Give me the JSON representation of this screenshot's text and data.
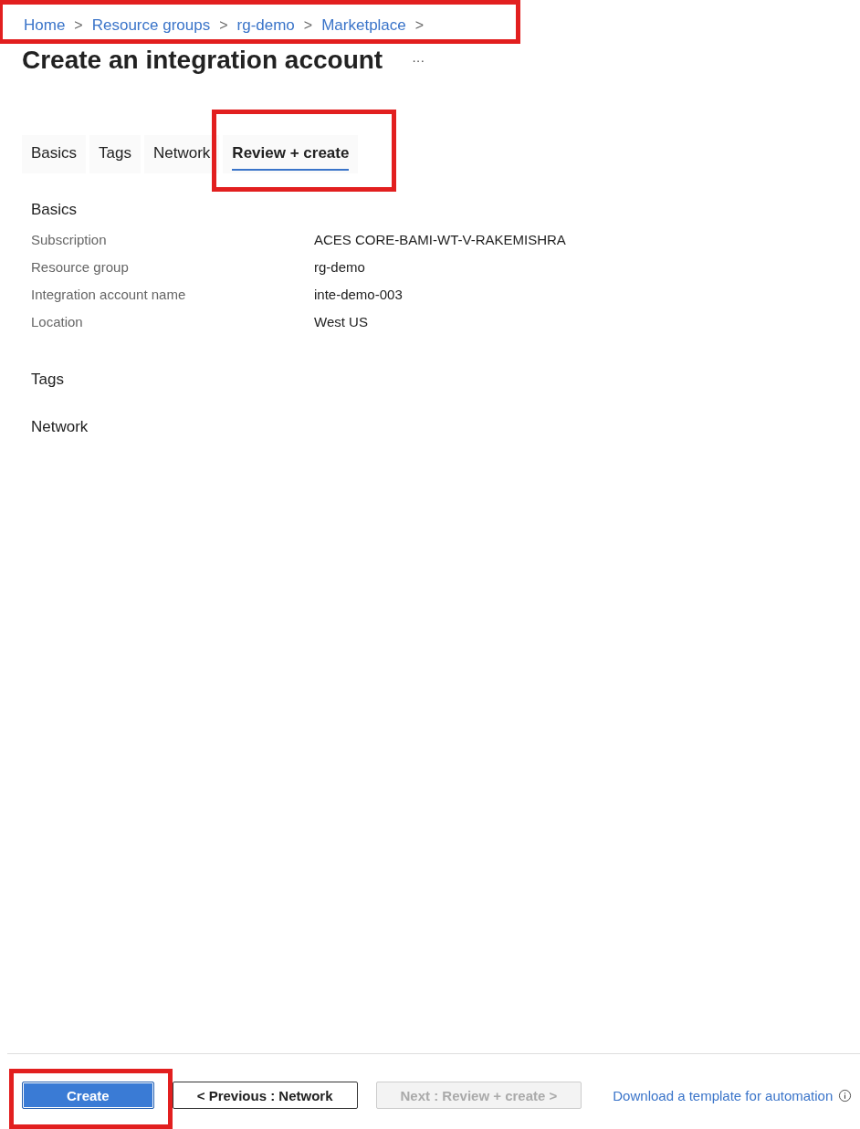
{
  "breadcrumb": {
    "highlighted": true,
    "items": [
      "Home",
      "Resource groups",
      "rg-demo",
      "Marketplace"
    ],
    "separator": ">"
  },
  "title": "Create an integration account",
  "more": "···",
  "tabs": [
    {
      "label": "Basics",
      "selected": false,
      "highlighted": false
    },
    {
      "label": "Tags",
      "selected": false,
      "highlighted": false
    },
    {
      "label": "Network",
      "selected": false,
      "highlighted": false
    },
    {
      "label": "Review + create",
      "selected": true,
      "highlighted": true
    }
  ],
  "sections": [
    {
      "heading": "Basics",
      "rows": [
        {
          "label": "Subscription",
          "value": "ACES CORE-BAMI-WT-V-RAKEMISHRA"
        },
        {
          "label": "Resource group",
          "value": "rg-demo"
        },
        {
          "label": "Integration account name",
          "value": "inte-demo-003"
        },
        {
          "label": "Location",
          "value": "West US"
        }
      ]
    },
    {
      "heading": "Tags"
    },
    {
      "heading": "Network"
    }
  ],
  "footer": {
    "buttons": [
      {
        "label": "Create",
        "kind": "primary",
        "disabled": false,
        "highlighted": true
      },
      {
        "label": "< Previous : Network",
        "kind": "secondary",
        "disabled": false,
        "highlighted": false
      },
      {
        "label": "Next : Review + create >",
        "kind": "secondary",
        "disabled": true,
        "highlighted": false
      }
    ],
    "link": "Download a template for automation"
  }
}
